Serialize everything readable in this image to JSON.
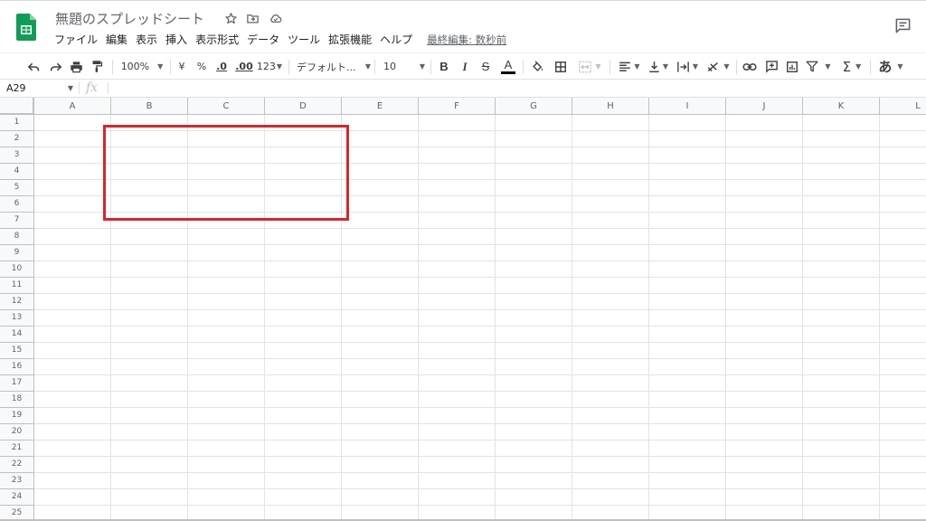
{
  "header": {
    "title": "無題のスプレッドシート",
    "last_edit": "最終編集: 数秒前"
  },
  "menu": [
    "ファイル",
    "編集",
    "表示",
    "挿入",
    "表示形式",
    "データ",
    "ツール",
    "拡張機能",
    "ヘルプ"
  ],
  "toolbar": {
    "zoom": "100%",
    "currency": "¥",
    "percent": "%",
    "decrease_decimal": ".0",
    "increase_decimal": ".00",
    "more_formats": "123",
    "font": "デフォルト...",
    "font_size": "10",
    "bold": "B",
    "italic": "I",
    "strikethrough": "S",
    "text_color": "A",
    "input_tools": "あ",
    "function": "Σ"
  },
  "formula_bar": {
    "name_box": "A29",
    "fx": "fx",
    "value": ""
  },
  "grid": {
    "columns": [
      "A",
      "B",
      "C",
      "D",
      "E",
      "F",
      "G",
      "H",
      "I",
      "J",
      "K",
      "L"
    ],
    "rows": [
      "1",
      "2",
      "3",
      "4",
      "5",
      "6",
      "7",
      "8",
      "9",
      "10",
      "11",
      "12",
      "13",
      "14",
      "15",
      "16",
      "17",
      "18",
      "19",
      "20",
      "21",
      "22",
      "23",
      "24",
      "25"
    ]
  },
  "colors": {
    "sheets_green": "#0f9d58",
    "highlight_red": "#d9262a",
    "header_bg": "#f8f9fa",
    "grid_line": "#e2e3e3"
  }
}
